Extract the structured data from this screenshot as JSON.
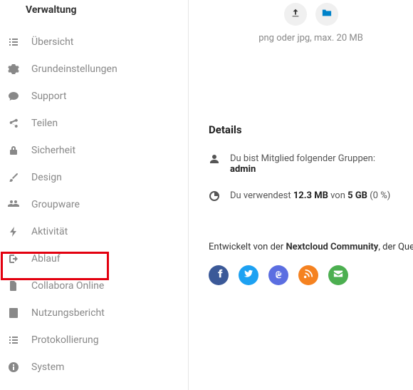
{
  "sidebar": {
    "section_title": "Verwaltung",
    "items": [
      {
        "label": "Übersicht"
      },
      {
        "label": "Grundeinstellungen"
      },
      {
        "label": "Support"
      },
      {
        "label": "Teilen"
      },
      {
        "label": "Sicherheit"
      },
      {
        "label": "Design"
      },
      {
        "label": "Groupware"
      },
      {
        "label": "Aktivität"
      },
      {
        "label": "Ablauf"
      },
      {
        "label": "Collabora Online"
      },
      {
        "label": "Nutzungsbericht"
      },
      {
        "label": "Protokollierung"
      },
      {
        "label": "System"
      }
    ]
  },
  "upload": {
    "hint": "png oder jpg, max. 20 MB"
  },
  "details": {
    "title": "Details",
    "member_prefix": "Du bist Mitglied folgender Gruppen:",
    "member_group": "admin",
    "usage_prefix": "Du verwendest ",
    "usage_used": "12.3 MB",
    "usage_middle": " von ",
    "usage_total": "5 GB",
    "usage_suffix": " (0 %)"
  },
  "credits": {
    "prefix": "Entwickelt von der ",
    "community": "Nextcloud Community",
    "middle": ", der ",
    "tail": "Quell"
  }
}
